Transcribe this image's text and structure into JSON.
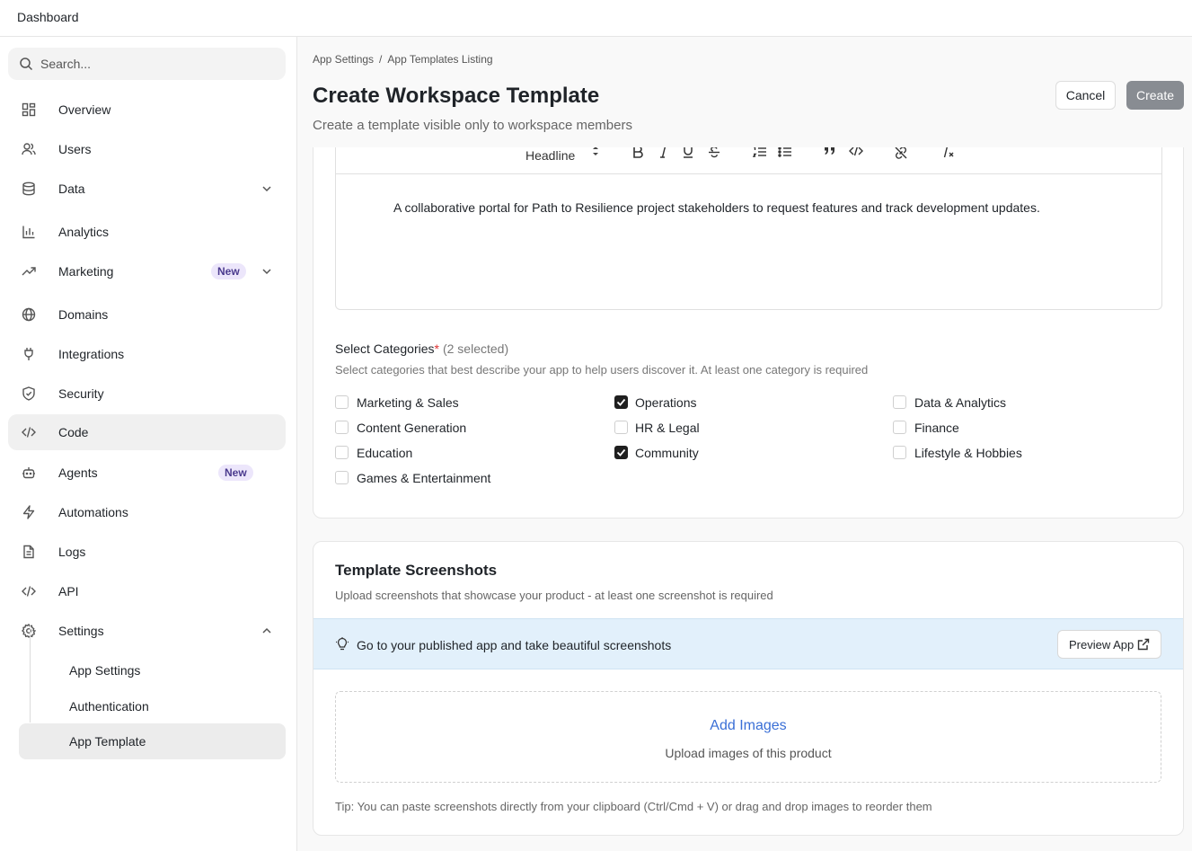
{
  "app": {
    "title": "Dashboard"
  },
  "search": {
    "placeholder": "Search..."
  },
  "sidebar": {
    "items": [
      {
        "label": "Overview",
        "icon": "overview-icon"
      },
      {
        "label": "Users",
        "icon": "users-icon"
      },
      {
        "label": "Data",
        "icon": "database-icon"
      },
      {
        "label": "Analytics",
        "icon": "analytics-icon"
      },
      {
        "label": "Marketing",
        "icon": "trending-icon",
        "badge": "New"
      },
      {
        "label": "Domains",
        "icon": "globe-icon"
      },
      {
        "label": "Integrations",
        "icon": "plug-icon"
      },
      {
        "label": "Security",
        "icon": "shield-icon"
      },
      {
        "label": "Code",
        "icon": "code-icon"
      },
      {
        "label": "Agents",
        "icon": "bot-icon",
        "badge": "New"
      },
      {
        "label": "Automations",
        "icon": "bolt-icon"
      },
      {
        "label": "Logs",
        "icon": "file-icon"
      },
      {
        "label": "API",
        "icon": "code-icon"
      },
      {
        "label": "Settings",
        "icon": "gear-icon"
      }
    ],
    "settings_children": [
      {
        "label": "App Settings"
      },
      {
        "label": "Authentication"
      },
      {
        "label": "App Template"
      }
    ]
  },
  "breadcrumb": {
    "first": "App Settings",
    "separator": "/",
    "second": "App Templates Listing"
  },
  "page": {
    "title": "Create Workspace Template",
    "subtitle": "Create a template visible only to workspace members",
    "cancel_label": "Cancel",
    "create_label": "Create"
  },
  "editor": {
    "heading_select": "Headline",
    "content": "A collaborative portal for Path to Resilience project stakeholders to request features and track development updates."
  },
  "categories": {
    "label": "Select Categories",
    "required_mark": "*",
    "count": "(2 selected)",
    "description": "Select categories that best describe your app to help users discover it. At least one category is required",
    "options": [
      {
        "label": "Marketing & Sales",
        "checked": false
      },
      {
        "label": "Content Generation",
        "checked": false
      },
      {
        "label": "Education",
        "checked": false
      },
      {
        "label": "Games & Entertainment",
        "checked": false
      },
      {
        "label": "Operations",
        "checked": true
      },
      {
        "label": "HR & Legal",
        "checked": false
      },
      {
        "label": "Community",
        "checked": true
      },
      {
        "label": "Data & Analytics",
        "checked": false
      },
      {
        "label": "Finance",
        "checked": false
      },
      {
        "label": "Lifestyle & Hobbies",
        "checked": false
      }
    ]
  },
  "screenshots": {
    "title": "Template Screenshots",
    "description": "Upload screenshots that showcase your product - at least one screenshot is required",
    "tip_banner": "Go to your published app and take beautiful screenshots",
    "preview_label": "Preview App",
    "add_images": "Add Images",
    "upload_hint": "Upload images of this product",
    "footer_tip": "Tip: You can paste screenshots directly from your clipboard (Ctrl/Cmd + V) or drag and drop images to reorder them"
  },
  "colors": {
    "badge_bg": "#ece6fb",
    "link": "#3a6fd6",
    "banner_bg": "#e2f0fb",
    "create_btn": "#888c92"
  }
}
